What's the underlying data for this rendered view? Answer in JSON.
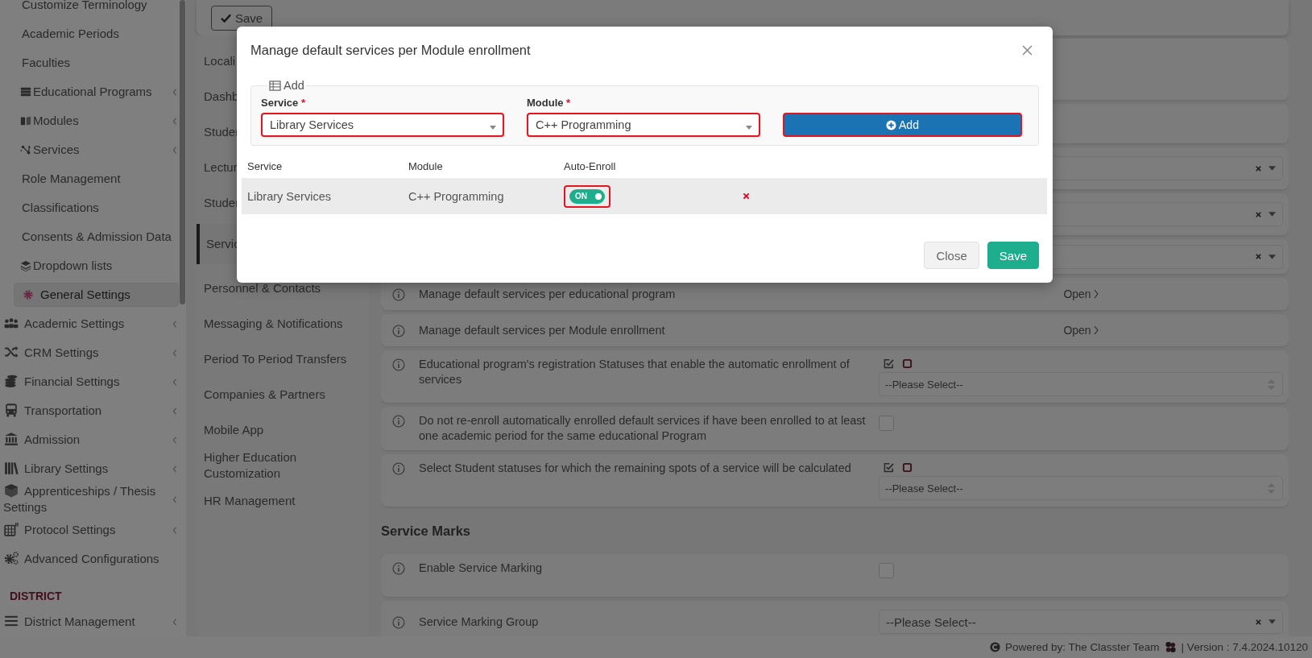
{
  "top_bar": {
    "save_button": "Save"
  },
  "sidebar": {
    "items": [
      {
        "label": "Customize Terminology",
        "kind": "sub",
        "expandable": false,
        "selected": false
      },
      {
        "label": "Academic Periods",
        "kind": "sub",
        "expandable": false,
        "selected": false
      },
      {
        "label": "Faculties",
        "kind": "sub",
        "expandable": false,
        "selected": false
      },
      {
        "label": "Educational Programs",
        "kind": "sub_icon",
        "expandable": true,
        "selected": false
      },
      {
        "label": "Modules",
        "kind": "sub_icon",
        "expandable": true,
        "selected": false
      },
      {
        "label": "Services",
        "kind": "sub_icon",
        "expandable": true,
        "selected": false
      },
      {
        "label": "Role Management",
        "kind": "sub",
        "expandable": false,
        "selected": false
      },
      {
        "label": "Classifications",
        "kind": "sub",
        "expandable": false,
        "selected": false
      },
      {
        "label": "Consents & Admission Data",
        "kind": "sub",
        "expandable": false,
        "selected": false
      },
      {
        "label": "Dropdown lists",
        "kind": "sub_icon",
        "expandable": false,
        "selected": false
      },
      {
        "label": "General Settings",
        "kind": "sub_icon",
        "expandable": false,
        "selected": true
      },
      {
        "label": "Academic Settings",
        "kind": "top",
        "expandable": true,
        "selected": false
      },
      {
        "label": "CRM Settings",
        "kind": "top",
        "expandable": true,
        "selected": false
      },
      {
        "label": "Financial Settings",
        "kind": "top",
        "expandable": true,
        "selected": false
      },
      {
        "label": "Transportation",
        "kind": "top",
        "expandable": true,
        "selected": false
      },
      {
        "label": "Admission",
        "kind": "top",
        "expandable": true,
        "selected": false
      },
      {
        "label": "Library Settings",
        "kind": "top",
        "expandable": true,
        "selected": false
      },
      {
        "label": "Apprenticeships / Thesis Settings",
        "kind": "top",
        "expandable": true,
        "selected": false
      },
      {
        "label": "Protocol Settings",
        "kind": "top",
        "expandable": true,
        "selected": false
      },
      {
        "label": "Advanced Configurations",
        "kind": "top",
        "expandable": false,
        "selected": false
      }
    ],
    "section_heading": "DISTRICT",
    "district_items": [
      {
        "label": "District Management",
        "kind": "top",
        "expandable": true,
        "selected": false
      }
    ]
  },
  "settings_nav": {
    "items": [
      {
        "label": "Locali",
        "selected": false
      },
      {
        "label": "Dashb",
        "selected": false
      },
      {
        "label": "Studer",
        "selected": false
      },
      {
        "label": "Lectur",
        "selected": false
      },
      {
        "label": "Studer",
        "selected": false
      },
      {
        "label": "Servic",
        "selected": true
      },
      {
        "label": "Personnel & Contacts",
        "selected": false
      },
      {
        "label": "Messaging & Notifications",
        "selected": false
      },
      {
        "label": "Period To Period Transfers",
        "selected": false
      },
      {
        "label": "Companies & Partners",
        "selected": false
      },
      {
        "label": "Mobile App",
        "selected": false
      },
      {
        "label": "Higher Education Customization",
        "selected": false
      },
      {
        "label": "HR Management",
        "selected": false
      }
    ]
  },
  "settings": {
    "rows": [
      {
        "kind": "card"
      },
      {
        "kind": "card"
      },
      {
        "kind": "select",
        "clearable": true
      },
      {
        "kind": "select",
        "clearable": true
      },
      {
        "kind": "select",
        "clearable": true
      },
      {
        "kind": "open",
        "label": "Manage default services per educational program",
        "link": "Open"
      },
      {
        "kind": "open",
        "label": "Manage default services per Module enrollment",
        "link": "Open"
      },
      {
        "kind": "multiselect",
        "label": "Educational program's registration Statuses that enable the automatic enrollment of services",
        "placeholder": "--Please Select--"
      },
      {
        "kind": "checkbox",
        "label": "Do not re-enroll automatically enrolled default services if have been enrolled to at least one academic period for the same educational Program",
        "checked": false
      },
      {
        "kind": "multiselect",
        "label": "Select Student statuses for which the remaining spots of a service will be calculated",
        "placeholder": "--Please Select--"
      },
      {
        "kind": "heading",
        "label": "Service Marks"
      },
      {
        "kind": "checkbox",
        "label": "Enable Service Marking",
        "checked": false
      },
      {
        "kind": "select",
        "label": "Service Marking Group",
        "placeholder": "--Please Select--",
        "clearable": true
      }
    ]
  },
  "footer": {
    "powered_by": "Powered by: The Classter Team",
    "version": "| Version : 7.4.2024.10120"
  },
  "modal": {
    "title": "Manage default services per Module enrollment",
    "legend": "Add",
    "fields": [
      {
        "label": "Service",
        "required_mark": "*",
        "value": "Library Services",
        "highlighted": true
      },
      {
        "label": "Module",
        "required_mark": "*",
        "value": "C++ Programming",
        "highlighted": true
      }
    ],
    "add_button": {
      "label": "Add",
      "highlighted": true
    },
    "table": {
      "columns": [
        "Service",
        "Module",
        "Auto-Enroll"
      ],
      "rows": [
        {
          "service": "Library Services",
          "module": "C++ Programming",
          "auto_enroll": {
            "label": "ON",
            "on": true,
            "highlighted": true
          }
        }
      ]
    },
    "buttons": [
      {
        "label": "Close",
        "kind": "secondary"
      },
      {
        "label": "Save",
        "kind": "primary"
      }
    ]
  }
}
